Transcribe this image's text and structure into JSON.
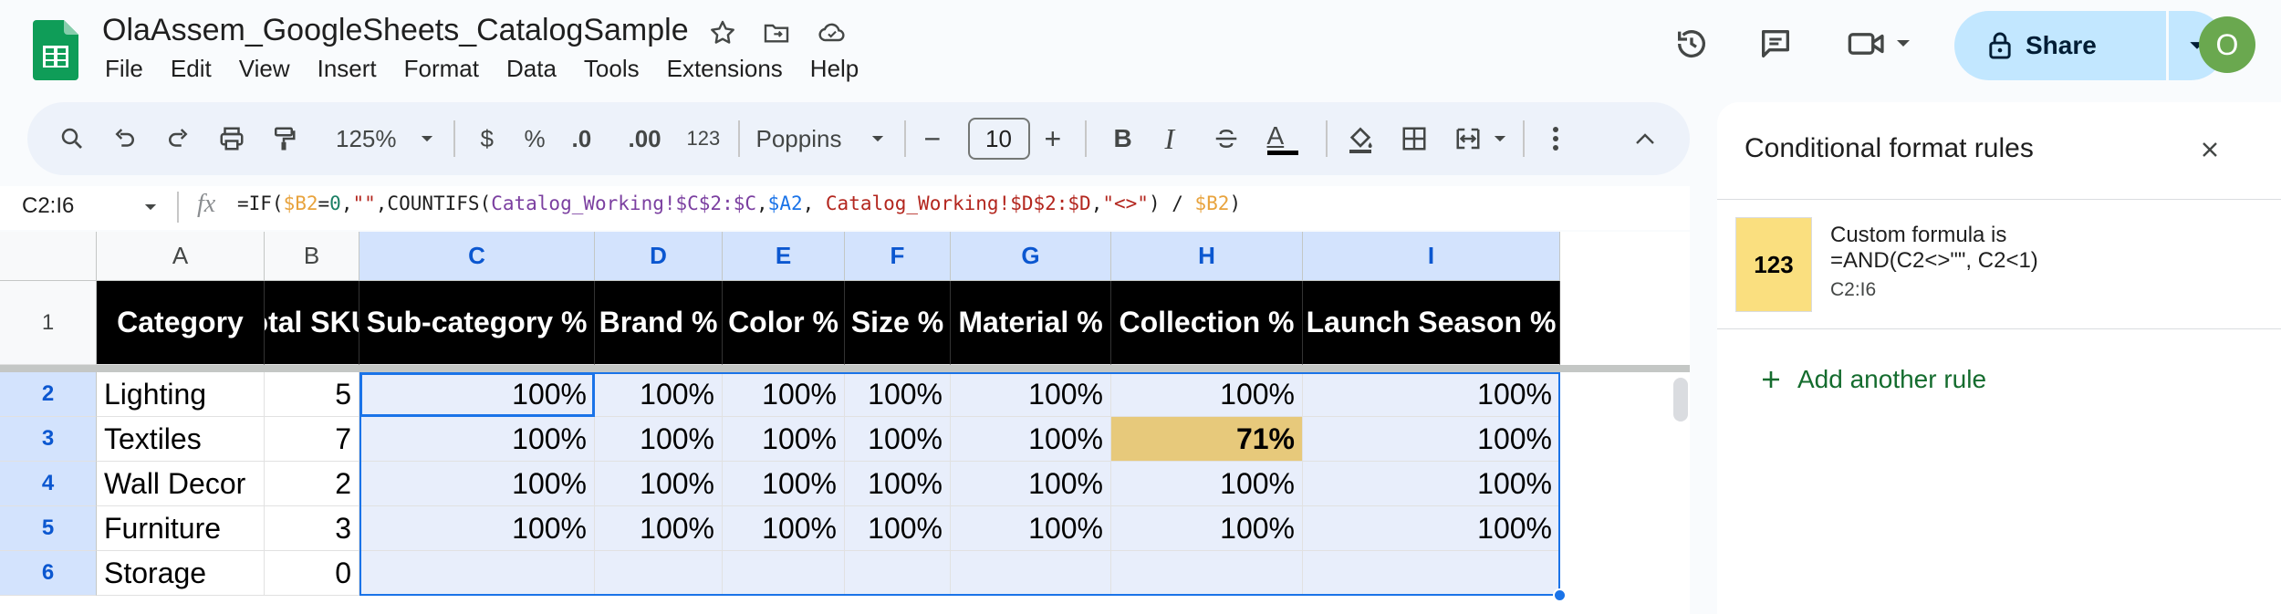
{
  "doc": {
    "title": "OlaAssem_GoogleSheets_CatalogSample"
  },
  "menu": [
    "File",
    "Edit",
    "View",
    "Insert",
    "Format",
    "Data",
    "Tools",
    "Extensions",
    "Help"
  ],
  "header_right": {
    "share_label": "Share",
    "avatar_initial": "O"
  },
  "toolbar": {
    "zoom": "125%",
    "currency": "$",
    "percent": "%",
    "dec_decrease": ".0",
    "dec_increase": ".00",
    "number_format": "123",
    "font": "Poppins",
    "font_size": "10",
    "minus": "−",
    "plus": "+",
    "bold": "B",
    "italic": "I",
    "text_color_letter": "A"
  },
  "formula_bar": {
    "name_box": "C2:I6",
    "fx": "fx",
    "formula_parts": [
      {
        "t": "=IF(",
        "c": "#1f1f1f"
      },
      {
        "t": "$B2",
        "c": "#e8a33d"
      },
      {
        "t": "=",
        "c": "#1f1f1f"
      },
      {
        "t": "0",
        "c": "#1a7f64"
      },
      {
        "t": ",",
        "c": "#1f1f1f"
      },
      {
        "t": "\"\"",
        "c": "#b3261e"
      },
      {
        "t": ",COUNTIFS(",
        "c": "#1f1f1f"
      },
      {
        "t": "Catalog_Working!$C$2:$C",
        "c": "#7b3fa0"
      },
      {
        "t": ",",
        "c": "#1f1f1f"
      },
      {
        "t": "$A2",
        "c": "#1a73e8"
      },
      {
        "t": ", ",
        "c": "#1f1f1f"
      },
      {
        "t": "Catalog_Working!$D$2:$D",
        "c": "#b3261e"
      },
      {
        "t": ",",
        "c": "#1f1f1f"
      },
      {
        "t": "\"<>\"",
        "c": "#b3261e"
      },
      {
        "t": ") / ",
        "c": "#1f1f1f"
      },
      {
        "t": "$B2",
        "c": "#e8a33d"
      },
      {
        "t": ")",
        "c": "#1f1f1f"
      }
    ]
  },
  "sheet": {
    "columns": [
      "A",
      "B",
      "C",
      "D",
      "E",
      "F",
      "G",
      "H",
      "I"
    ],
    "selected_columns": [
      "C",
      "D",
      "E",
      "F",
      "G",
      "H",
      "I"
    ],
    "row_numbers": [
      "1",
      "2",
      "3",
      "4",
      "5",
      "6"
    ],
    "header_row": [
      "Category",
      "Total SKUs",
      "Sub-category %",
      "Brand %",
      "Color %",
      "Size %",
      "Material %",
      "Collection %",
      "Launch Season %"
    ],
    "rows": [
      [
        "Lighting",
        "5",
        "100%",
        "100%",
        "100%",
        "100%",
        "100%",
        "100%",
        "100%"
      ],
      [
        "Textiles",
        "7",
        "100%",
        "100%",
        "100%",
        "100%",
        "100%",
        "71%",
        "100%"
      ],
      [
        "Wall Decor",
        "2",
        "100%",
        "100%",
        "100%",
        "100%",
        "100%",
        "100%",
        "100%"
      ],
      [
        "Furniture",
        "3",
        "100%",
        "100%",
        "100%",
        "100%",
        "100%",
        "100%",
        "100%"
      ],
      [
        "Storage",
        "0",
        "",
        "",
        "",
        "",
        "",
        "",
        ""
      ]
    ],
    "highlight_color": "#e7c97b",
    "selection_color": "#1a73e8"
  },
  "panel": {
    "title": "Conditional format rules",
    "rule": {
      "swatch_text": "123",
      "line1": "Custom formula is",
      "line2": "=AND(C2<>\"\", C2<1)",
      "range": "C2:I6",
      "swatch_color": "#fadf7f"
    },
    "add_rule_label": "Add another rule"
  }
}
